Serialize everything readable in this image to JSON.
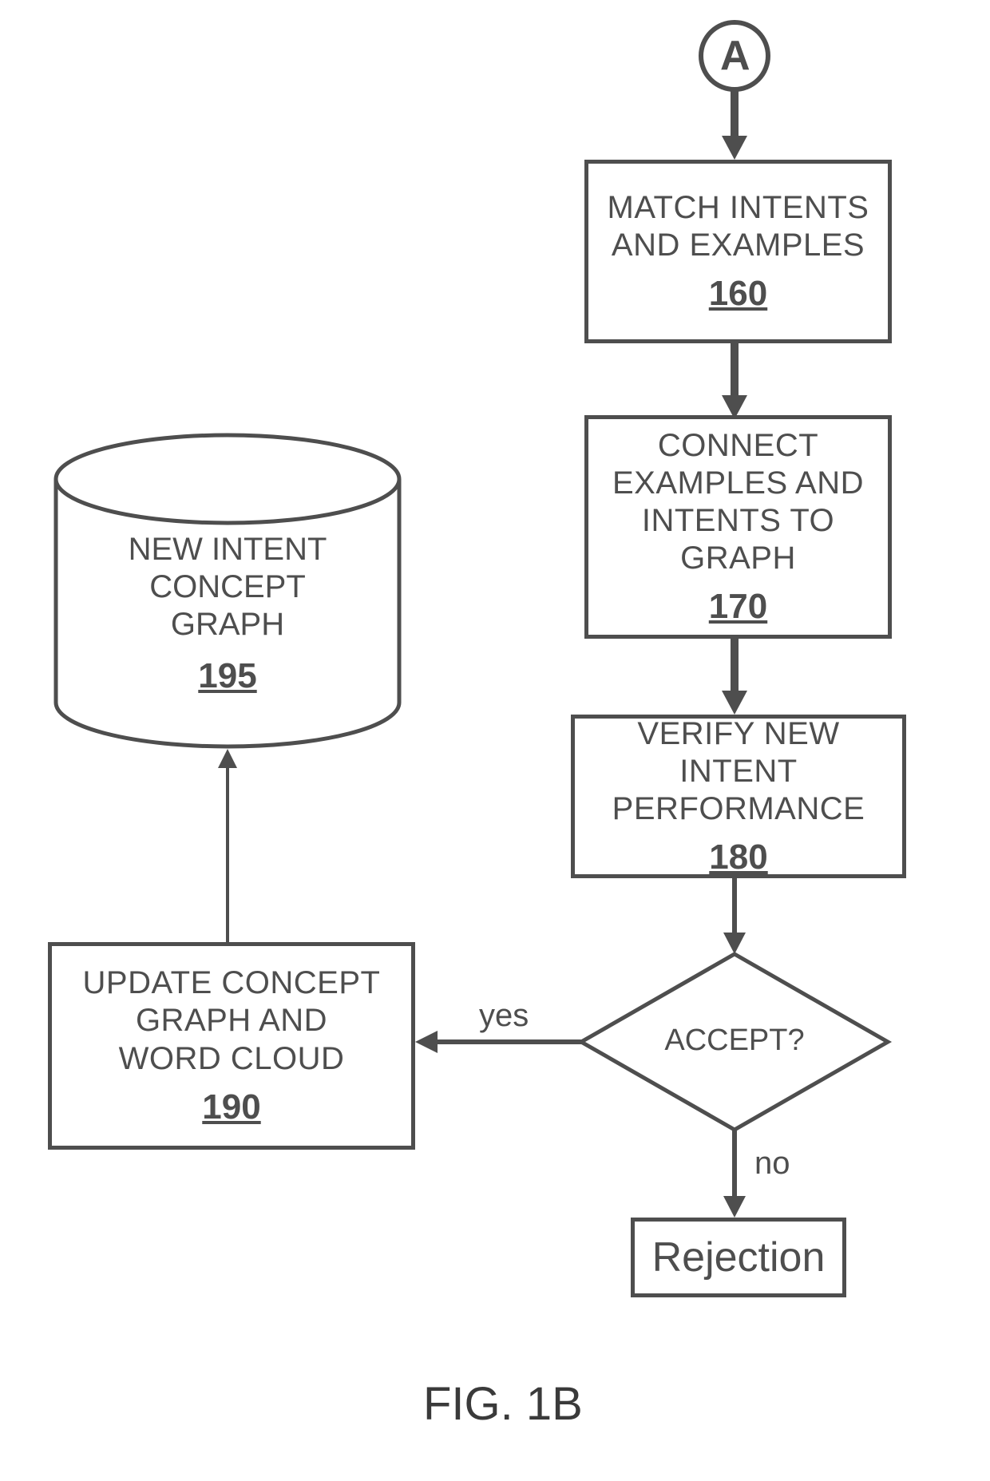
{
  "connector": {
    "label": "A"
  },
  "nodes": {
    "n160": {
      "label": "MATCH INTENTS\nAND EXAMPLES",
      "num": "160"
    },
    "n170": {
      "label": "CONNECT\nEXAMPLES AND\nINTENTS TO GRAPH",
      "num": "170"
    },
    "n180": {
      "label": "VERIFY NEW INTENT\nPERFORMANCE",
      "num": "180"
    },
    "decision": {
      "label": "ACCEPT?"
    },
    "n190": {
      "label": "UPDATE CONCEPT\nGRAPH AND\nWORD CLOUD",
      "num": "190"
    },
    "n195": {
      "label": "NEW INTENT\nCONCEPT\nGRAPH",
      "num": "195"
    },
    "rejection": {
      "label": "Rejection"
    }
  },
  "edges": {
    "yes": "yes",
    "no": "no"
  },
  "figure": {
    "label": "FIG. 1B"
  }
}
